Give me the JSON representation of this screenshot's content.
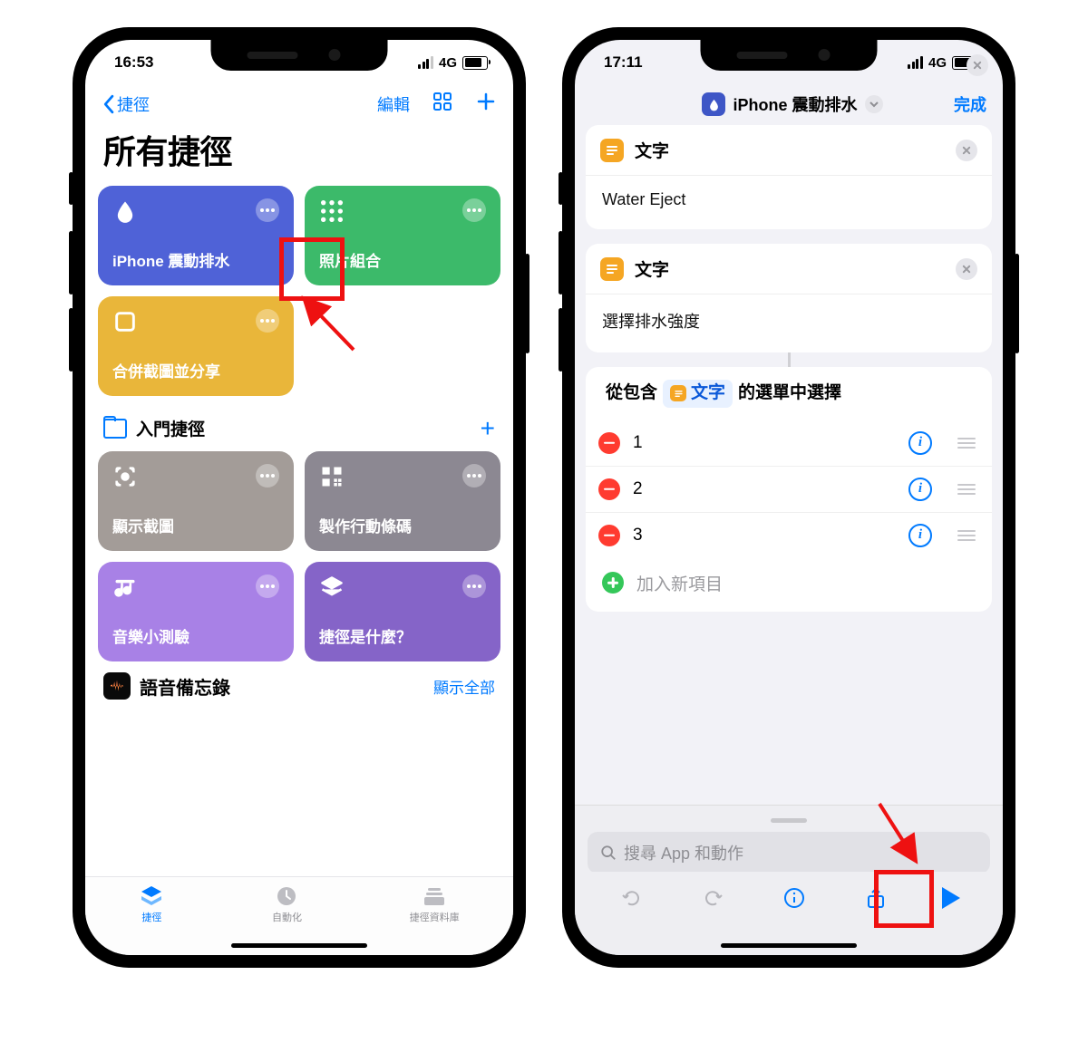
{
  "left": {
    "status": {
      "time": "16:53",
      "network": "4G"
    },
    "nav": {
      "back": "捷徑",
      "edit": "編輯"
    },
    "title": "所有捷徑",
    "tiles": [
      {
        "label": "iPhone 震動排水",
        "cls": "t-blue",
        "icon": "drop"
      },
      {
        "label": "照片組合",
        "cls": "t-green",
        "icon": "dots9"
      },
      {
        "label": "合併截圖並分享",
        "cls": "t-yellow",
        "icon": "square"
      }
    ],
    "section": "入門捷徑",
    "starters": [
      {
        "label": "顯示截圖",
        "cls": "t-gray1",
        "icon": "capture"
      },
      {
        "label": "製作行動條碼",
        "cls": "t-gray2",
        "icon": "qr"
      },
      {
        "label": "音樂小測驗",
        "cls": "t-purple1",
        "icon": "music"
      },
      {
        "label": "捷徑是什麼？",
        "cls": "t-purple2",
        "icon": "layers"
      }
    ],
    "voice": "語音備忘錄",
    "show_all": "顯示全部",
    "tabs": {
      "shortcuts": "捷徑",
      "automation": "自動化",
      "gallery": "捷徑資料庫"
    }
  },
  "right": {
    "status": {
      "time": "17:11",
      "network": "4G"
    },
    "title": "iPhone 震動排水",
    "done": "完成",
    "actions": [
      {
        "title": "文字",
        "body": "Water Eject"
      },
      {
        "title": "文字",
        "body": "選擇排水強度"
      }
    ],
    "menu_action": {
      "prefix": "從包含",
      "pill": "文字",
      "suffix": "的選單中選擇"
    },
    "options": [
      "1",
      "2",
      "3"
    ],
    "add_item": "加入新項目",
    "search_placeholder": "搜尋 App 和動作"
  }
}
